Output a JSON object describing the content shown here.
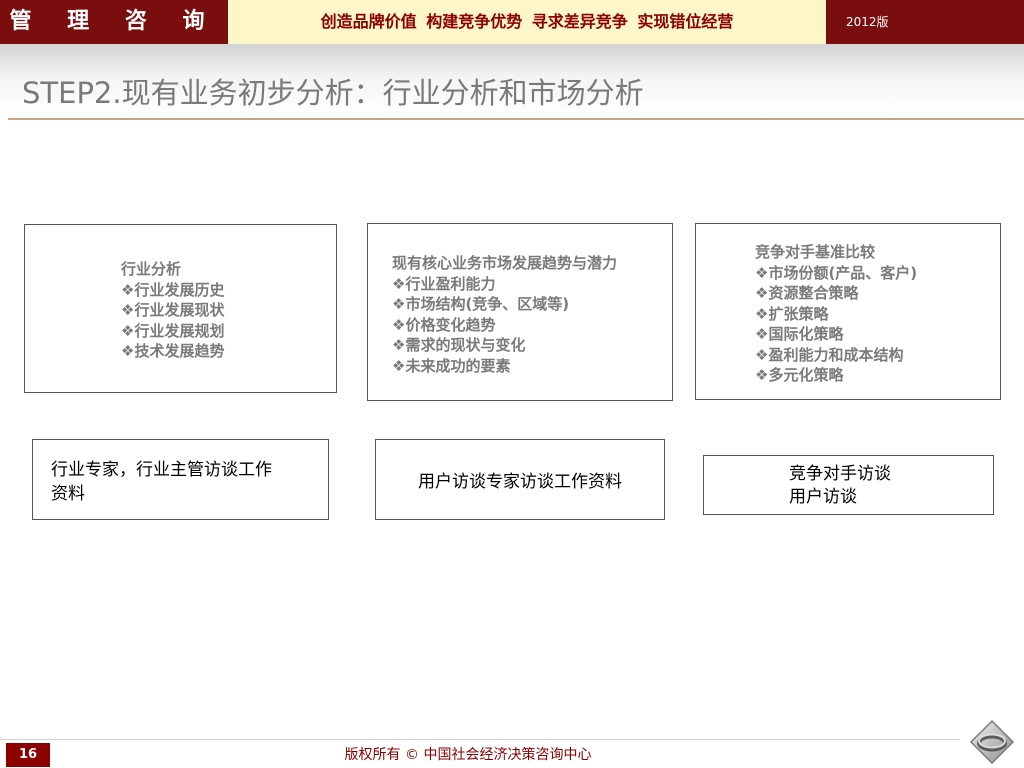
{
  "header": {
    "brand": "管 理 咨 询",
    "slogan": "创造品牌价值 构建竞争优势 寻求差异竞争 实现错位经营",
    "edition": "2012版"
  },
  "title": "STEP2.现有业务初步分析：行业分析和市场分析",
  "boxes": [
    {
      "heading": "行业分析",
      "items": [
        "❖行业发展历史",
        "❖行业发展现状",
        "❖行业发展规划",
        "❖技术发展趋势"
      ]
    },
    {
      "heading": "现有核心业务市场发展趋势与潜力",
      "items": [
        "❖行业盈利能力",
        "❖市场结构(竞争、区域等)",
        "❖价格变化趋势",
        "❖需求的现状与变化",
        "❖未来成功的要素"
      ]
    },
    {
      "heading": "竞争对手基准比较",
      "items": [
        "❖市场份额(产品、客户)",
        "❖资源整合策略",
        "❖扩张策略",
        "❖国际化策略",
        "❖盈利能力和成本结构",
        "❖多元化策略"
      ]
    }
  ],
  "sources": [
    {
      "lines": [
        "行业专家，行业主管访谈工作",
        "资料"
      ]
    },
    {
      "lines": [
        "用户访谈专家访谈工作资料"
      ]
    },
    {
      "lines": [
        "竞争对手访谈",
        "用户访谈"
      ]
    }
  ],
  "footer": {
    "page_number": "16",
    "copyright": "版权所有 © 中国社会经济决策咨询中心"
  },
  "icons": {
    "logo": "diamond-ring-logo-icon"
  }
}
